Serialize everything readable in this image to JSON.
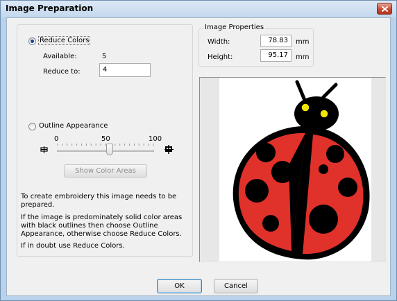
{
  "window": {
    "title": "Image Preparation",
    "close_icon": "close-icon"
  },
  "mode": {
    "reduce_colors_label": "Reduce Colors",
    "reduce_colors_selected": true,
    "available_label": "Available:",
    "available_value": "5",
    "reduce_to_label": "Reduce to:",
    "reduce_to_value": "4",
    "outline_label": "Outline Appearance",
    "outline_selected": false
  },
  "slider": {
    "min_label": "0",
    "mid_label": "50",
    "max_label": "100",
    "value": 50,
    "show_color_areas_label": "Show Color Areas"
  },
  "help": {
    "p1": "To create embroidery this image needs to be prepared.",
    "p2": "If the image is predominately solid color areas with black outlines then choose Outline Appearance, otherwise choose Reduce Colors.",
    "p3": "If in doubt use Reduce Colors."
  },
  "properties": {
    "title": "Image Properties",
    "width_label": "Width:",
    "width_value": "78.83",
    "height_label": "Height:",
    "height_value": "95.17",
    "unit": "mm"
  },
  "preview": {
    "subject": "ladybug-image"
  },
  "footer": {
    "ok_label": "OK",
    "cancel_label": "Cancel"
  },
  "colors": {
    "title_bar": "#c4d8ee",
    "dialog_bg": "#f0f0f0",
    "ladybug_red": "#e0312b",
    "ladybug_eyes": "#f2e600"
  }
}
